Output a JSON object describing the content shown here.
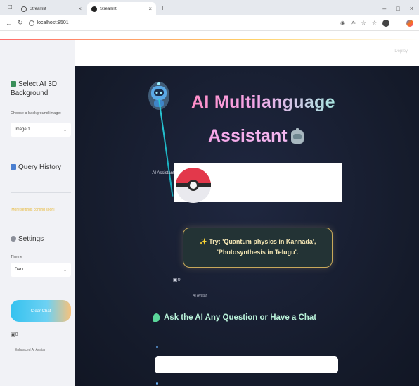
{
  "browser": {
    "tabs": [
      {
        "title": "Streamlit",
        "active": false
      },
      {
        "title": "Streamlit",
        "active": true
      }
    ],
    "url": "localhost:8501",
    "new_tab": "+"
  },
  "app": {
    "deploy_label": "Deploy"
  },
  "sidebar": {
    "bg_heading": "Select AI 3D Background",
    "bg_select_label": "Choose a background image:",
    "bg_select_value": "Image 1",
    "history_heading": "Query History",
    "settings_note": "[More settings coming soon]",
    "settings_heading": "Settings",
    "theme_label": "Theme",
    "theme_value": "Dark",
    "clear_button": "Clear Chat",
    "avatar_alt": "0",
    "avatar_caption": "Enhanced AI Avatar"
  },
  "main": {
    "title_line1": "AI Multilanguage",
    "title_line2": "Assistant",
    "ai_label": "AI Assistant",
    "try_text": "✨ Try: 'Quantum physics in Kannada', 'Photosynthesis in Telugu'.",
    "avatar_alt": "0",
    "avatar_caption": "AI Avatar",
    "ask_heading": "Ask the AI Any Question or Have a Chat",
    "chat_input_value": "",
    "chat_input_placeholder": ""
  },
  "colors": {
    "main_bg": "#151b2b",
    "sidebar_bg": "#f1f2f6",
    "clear_button_gradient_start": "#35c2ef",
    "clear_button_gradient_end": "#f6c27c",
    "title_pink": "#ff8ec7",
    "title_teal": "#a8e6e0",
    "try_border": "#c8a85a",
    "ask_heading": "#b9f1d9"
  },
  "icons": [
    "tab-actions-icon",
    "streamlit-favicon",
    "close-tab-icon",
    "back-icon",
    "reload-icon",
    "info-icon",
    "read-aloud-icon",
    "favorites-icon",
    "profile-avatar",
    "more-icon",
    "copilot-icon",
    "image-icon",
    "books-icon",
    "gear-icon",
    "robot-icon",
    "pokeball-image",
    "broken-image-icon",
    "leaf-icon"
  ]
}
